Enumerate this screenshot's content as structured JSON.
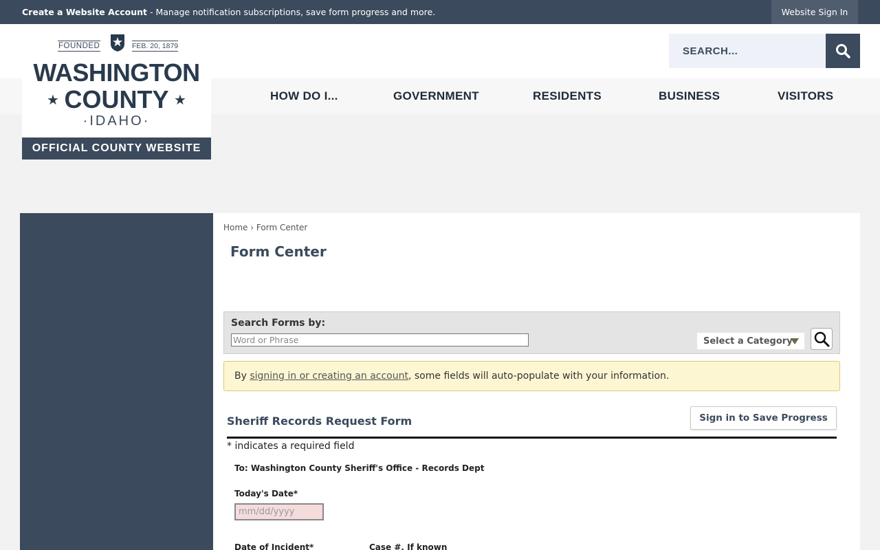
{
  "topbar": {
    "account_link": "Create a Website Account",
    "account_desc": " - Manage notification subscriptions, save form progress and more.",
    "signin": "Website Sign In"
  },
  "logo": {
    "founded": "FOUNDED",
    "date": "FEB. 20, 1879",
    "line1": "WASHINGTON",
    "line2": "COUNTY",
    "line3": "·IDAHO·",
    "tagline": "OFFICIAL COUNTY WEBSITE"
  },
  "search": {
    "placeholder": "SEARCH..."
  },
  "nav": [
    "HOW DO I...",
    "GOVERNMENT",
    "RESIDENTS",
    "BUSINESS",
    "VISITORS"
  ],
  "breadcrumb": {
    "home": "Home",
    "sep": "›",
    "current": "Form Center"
  },
  "page_title": "Form Center",
  "form_search": {
    "label": "Search Forms by:",
    "placeholder": "Word or Phrase",
    "category": "Select a Category"
  },
  "notice": {
    "prefix": "By ",
    "link": "signing in or creating an account",
    "suffix": ", some fields will auto-populate with your information."
  },
  "form": {
    "title": "Sheriff Records Request Form",
    "save_button": "Sign in to Save Progress",
    "required_note": "* indicates a required field",
    "to": "To: Washington County Sheriff's Office - Records Dept",
    "date_label": "Today's Date*",
    "date_placeholder": "mm/dd/yyyy",
    "incident_label": "Date of Incident*",
    "case_label": "Case #, If known"
  },
  "colors": {
    "primary": "#3b4a5c",
    "notice_bg": "#fdf6d3",
    "required_bg": "#f5dcdc"
  }
}
